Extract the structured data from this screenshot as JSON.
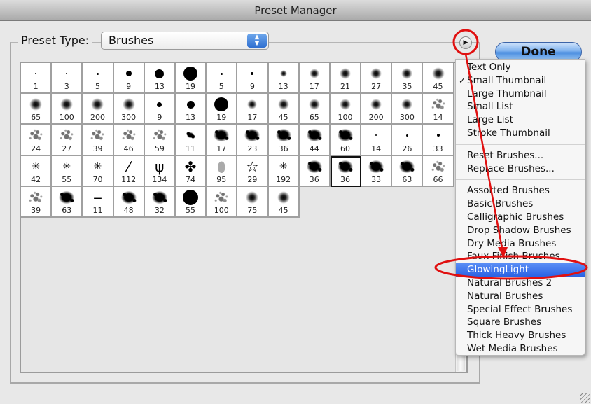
{
  "window": {
    "title": "Preset Manager"
  },
  "preset_type": {
    "label": "Preset Type:",
    "value": "Brushes"
  },
  "buttons": {
    "done": "Done",
    "gear_symbol": "▶"
  },
  "colors": {
    "menu_highlight": "#2a62e4",
    "annotation": "#e01010",
    "done_accent": "#4b8ee0"
  },
  "brushes": [
    {
      "size": "1",
      "kind": "hard",
      "d": 2
    },
    {
      "size": "3",
      "kind": "hard",
      "d": 2
    },
    {
      "size": "5",
      "kind": "hard",
      "d": 3
    },
    {
      "size": "9",
      "kind": "hard",
      "d": 8
    },
    {
      "size": "13",
      "kind": "hard",
      "d": 13
    },
    {
      "size": "19",
      "kind": "hard",
      "d": 20
    },
    {
      "size": "5",
      "kind": "hard",
      "d": 3
    },
    {
      "size": "9",
      "kind": "hard",
      "d": 4
    },
    {
      "size": "13",
      "kind": "soft",
      "d": 10
    },
    {
      "size": "17",
      "kind": "soft",
      "d": 14
    },
    {
      "size": "21",
      "kind": "soft",
      "d": 16
    },
    {
      "size": "27",
      "kind": "soft",
      "d": 16
    },
    {
      "size": "35",
      "kind": "soft",
      "d": 16
    },
    {
      "size": "45",
      "kind": "soft",
      "d": 18
    },
    {
      "size": "65",
      "kind": "soft",
      "d": 18
    },
    {
      "size": "100",
      "kind": "soft",
      "d": 18
    },
    {
      "size": "200",
      "kind": "soft",
      "d": 18
    },
    {
      "size": "300",
      "kind": "soft",
      "d": 18
    },
    {
      "size": "9",
      "kind": "hard",
      "d": 7
    },
    {
      "size": "13",
      "kind": "hard",
      "d": 11
    },
    {
      "size": "19",
      "kind": "hard",
      "d": 20
    },
    {
      "size": "17",
      "kind": "soft",
      "d": 14
    },
    {
      "size": "45",
      "kind": "soft",
      "d": 16
    },
    {
      "size": "65",
      "kind": "soft",
      "d": 16
    },
    {
      "size": "100",
      "kind": "soft",
      "d": 16
    },
    {
      "size": "200",
      "kind": "soft",
      "d": 16
    },
    {
      "size": "300",
      "kind": "soft",
      "d": 16
    },
    {
      "size": "14",
      "kind": "splat-light"
    },
    {
      "size": "24",
      "kind": "splat-light"
    },
    {
      "size": "27",
      "kind": "splat-light"
    },
    {
      "size": "39",
      "kind": "splat-light"
    },
    {
      "size": "46",
      "kind": "splat-light"
    },
    {
      "size": "59",
      "kind": "splat-light"
    },
    {
      "size": "11",
      "kind": "splat-small"
    },
    {
      "size": "17",
      "kind": "splat-dense"
    },
    {
      "size": "23",
      "kind": "splat-dense"
    },
    {
      "size": "36",
      "kind": "splat-dense"
    },
    {
      "size": "44",
      "kind": "splat-dense"
    },
    {
      "size": "60",
      "kind": "splat-dense"
    },
    {
      "size": "14",
      "kind": "hard",
      "d": 2
    },
    {
      "size": "26",
      "kind": "hard",
      "d": 3
    },
    {
      "size": "33",
      "kind": "hard",
      "d": 4
    },
    {
      "size": "42",
      "kind": "star-burst"
    },
    {
      "size": "55",
      "kind": "star-burst"
    },
    {
      "size": "70",
      "kind": "star-burst"
    },
    {
      "size": "112",
      "kind": "glyph",
      "glyph": "⁄"
    },
    {
      "size": "134",
      "kind": "glyph",
      "glyph": "ψ"
    },
    {
      "size": "74",
      "kind": "glyph",
      "glyph": "✤"
    },
    {
      "size": "95",
      "kind": "glyph-grey",
      "glyph": "⬮"
    },
    {
      "size": "29",
      "kind": "glyph",
      "glyph": "☆"
    },
    {
      "size": "192",
      "kind": "star-burst"
    },
    {
      "size": "36",
      "kind": "splat-dense"
    },
    {
      "size": "36",
      "kind": "splat-dense",
      "selected": true
    },
    {
      "size": "33",
      "kind": "splat-dense"
    },
    {
      "size": "63",
      "kind": "splat-dense"
    },
    {
      "size": "66",
      "kind": "splat-light"
    },
    {
      "size": "39",
      "kind": "splat-light"
    },
    {
      "size": "63",
      "kind": "splat-dense"
    },
    {
      "size": "11",
      "kind": "glyph",
      "glyph": "‒"
    },
    {
      "size": "48",
      "kind": "splat-dense"
    },
    {
      "size": "32",
      "kind": "splat-dense"
    },
    {
      "size": "55",
      "kind": "hard",
      "d": 22
    },
    {
      "size": "100",
      "kind": "splat-light"
    },
    {
      "size": "75",
      "kind": "soft",
      "d": 18
    },
    {
      "size": "45",
      "kind": "soft",
      "d": 18
    }
  ],
  "menu": {
    "view_items": [
      {
        "label": "Text Only",
        "checked": false
      },
      {
        "label": "Small Thumbnail",
        "checked": true
      },
      {
        "label": "Large Thumbnail",
        "checked": false
      },
      {
        "label": "Small List",
        "checked": false
      },
      {
        "label": "Large List",
        "checked": false
      },
      {
        "label": "Stroke Thumbnail",
        "checked": false
      }
    ],
    "action_items": [
      {
        "label": "Reset Brushes..."
      },
      {
        "label": "Replace Brushes..."
      }
    ],
    "library_items": [
      {
        "label": "Assorted Brushes"
      },
      {
        "label": "Basic Brushes"
      },
      {
        "label": "Calligraphic Brushes"
      },
      {
        "label": "Drop Shadow Brushes"
      },
      {
        "label": "Dry Media Brushes"
      },
      {
        "label": "Faux Finish Brushes"
      },
      {
        "label": "GlowingLight",
        "highlighted": true
      },
      {
        "label": "Natural Brushes 2"
      },
      {
        "label": "Natural Brushes"
      },
      {
        "label": "Special Effect Brushes"
      },
      {
        "label": "Square Brushes"
      },
      {
        "label": "Thick Heavy Brushes"
      },
      {
        "label": "Wet Media Brushes"
      }
    ],
    "check_symbol": "✓"
  }
}
